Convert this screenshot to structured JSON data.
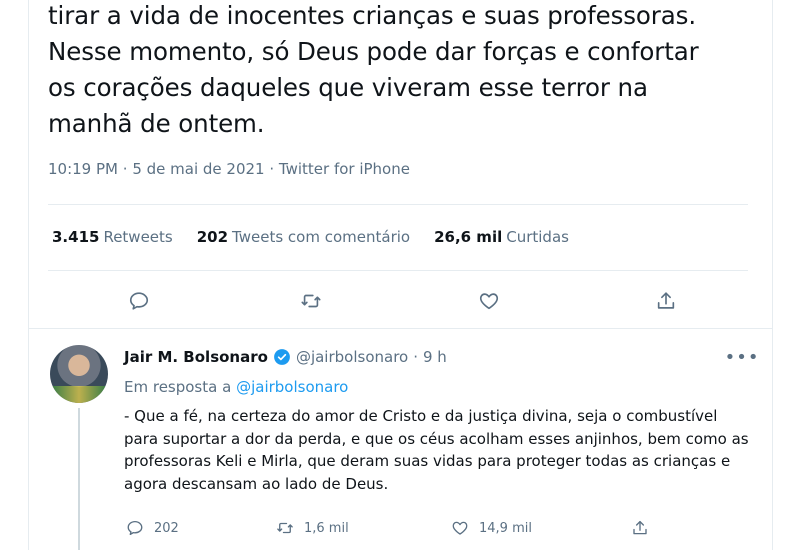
{
  "tweet": {
    "text": "tirar a vida de inocentes crianças e suas professoras.\nNesse momento, só Deus pode dar forças e confortar\nos corações daqueles que viveram esse terror na\nmanhã de ontem.",
    "time": "10:19 PM",
    "date": "5 de mai de 2021",
    "source": "Twitter for iPhone",
    "stats": {
      "retweets_count": "3.415",
      "retweets_label": "Retweets",
      "quotes_count": "202",
      "quotes_label": "Tweets com comentário",
      "likes_count": "26,6 mil",
      "likes_label": "Curtidas"
    },
    "actions": [
      "reply-icon",
      "retweet-icon",
      "like-icon",
      "share-icon"
    ]
  },
  "reply": {
    "name": "Jair M. Bolsonaro",
    "handle": "@jairbolsonaro",
    "time": "9 h",
    "replying_prefix": "Em resposta a",
    "replying_to": "@jairbolsonaro",
    "text": "- Que a fé, na certeza do amor de Cristo e da justiça divina, seja o combustível para suportar a dor da perda, e que os céus acolham esses anjinhos, bem como as professoras Keli e Mirla, que deram suas vidas para proteger todas as crianças e agora descansam ao lado de Deus.",
    "reply_count": "202",
    "retweet_count": "1,6 mil",
    "like_count": "14,9 mil"
  },
  "colors": {
    "secondary_text": "#5b7083",
    "link": "#1d9bf0",
    "verified": "#1d9bf0",
    "border": "#e6ecf0"
  }
}
